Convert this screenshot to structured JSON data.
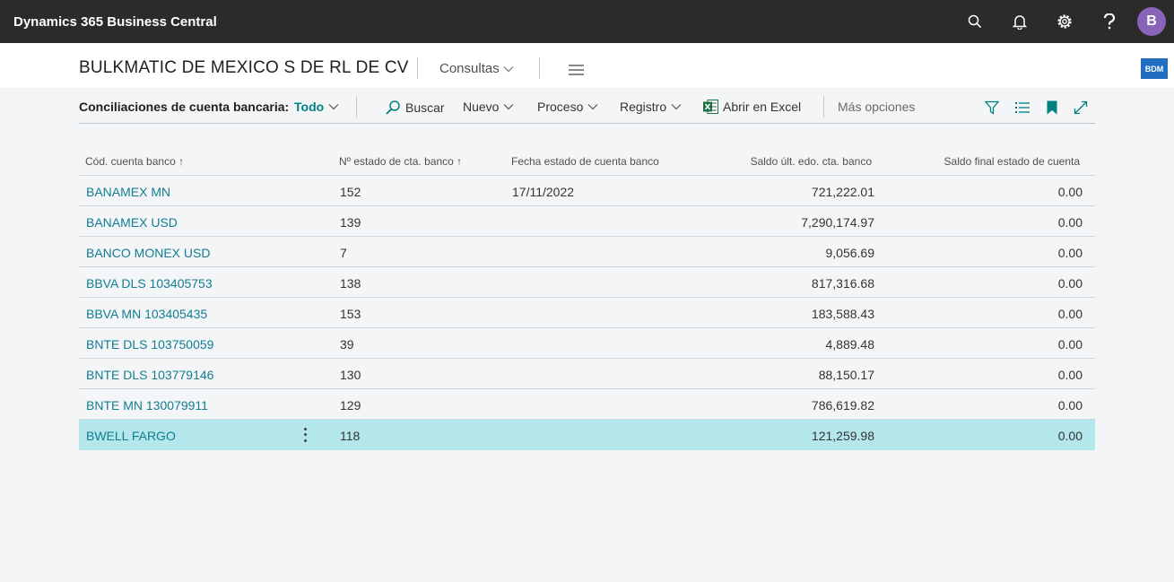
{
  "appbar": {
    "title": "Dynamics 365 Business Central",
    "icons": [
      "search-icon",
      "bell-icon",
      "gear-icon",
      "help-icon"
    ],
    "avatar_initial": "B",
    "avatar_color": "#8764b8"
  },
  "header": {
    "company": "BULKMATIC DE MEXICO S DE RL DE CV",
    "consultas_label": "Consultas",
    "badge": "BDM"
  },
  "actionbar": {
    "caption": "Conciliaciones de cuenta bancaria:",
    "view": "Todo",
    "buscar": "Buscar",
    "nuevo": "Nuevo",
    "proceso": "Proceso",
    "registro": "Registro",
    "excel": "Abrir en Excel",
    "more": "Más opciones",
    "tools": [
      "filter-icon",
      "list-icon",
      "bookmark-icon",
      "expand-icon"
    ]
  },
  "grid": {
    "columns": [
      {
        "label": "Cód. cuenta banco",
        "sort": "↑"
      },
      {
        "label": "Nº estado de cta. banco",
        "sort": "↑"
      },
      {
        "label": "Fecha estado de cuenta banco",
        "sort": ""
      },
      {
        "label": "Saldo últ. edo. cta. banco",
        "sort": ""
      },
      {
        "label": "Saldo final estado de cuenta",
        "sort": ""
      }
    ],
    "rows": [
      {
        "code": "BANAMEX MN",
        "statement_no": "152",
        "date": "17/11/2022",
        "last_balance": "721,222.01",
        "ending_balance": "0.00"
      },
      {
        "code": "BANAMEX USD",
        "statement_no": "139",
        "date": "",
        "last_balance": "7,290,174.97",
        "ending_balance": "0.00"
      },
      {
        "code": "BANCO MONEX USD",
        "statement_no": "7",
        "date": "",
        "last_balance": "9,056.69",
        "ending_balance": "0.00"
      },
      {
        "code": "BBVA DLS 103405753",
        "statement_no": "138",
        "date": "",
        "last_balance": "817,316.68",
        "ending_balance": "0.00"
      },
      {
        "code": "BBVA MN 103405435",
        "statement_no": "153",
        "date": "",
        "last_balance": "183,588.43",
        "ending_balance": "0.00"
      },
      {
        "code": "BNTE DLS 103750059",
        "statement_no": "39",
        "date": "",
        "last_balance": "4,889.48",
        "ending_balance": "0.00"
      },
      {
        "code": "BNTE DLS 103779146",
        "statement_no": "130",
        "date": "",
        "last_balance": "88,150.17",
        "ending_balance": "0.00"
      },
      {
        "code": "BNTE MN 130079911",
        "statement_no": "129",
        "date": "",
        "last_balance": "786,619.82",
        "ending_balance": "0.00"
      },
      {
        "code": "BWELL FARGO",
        "statement_no": "118",
        "date": "",
        "last_balance": "121,259.98",
        "ending_balance": "0.00",
        "selected": true
      }
    ]
  },
  "colors": {
    "accent": "#00807f",
    "link": "#117e92",
    "selected_row": "#b3e7ec",
    "appbar": "#2b2b2b",
    "badge": "#1f6ec1"
  }
}
